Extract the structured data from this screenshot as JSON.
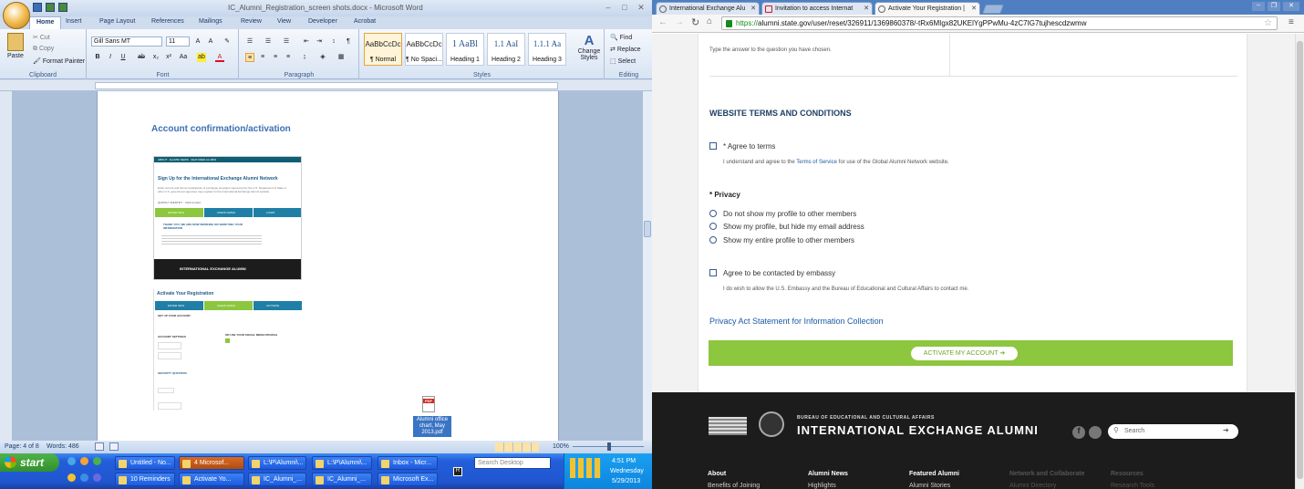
{
  "word": {
    "title": "IC_Alumni_Registration_screen shots.docx - Microsoft Word",
    "tabs": [
      "Home",
      "Insert",
      "Page Layout",
      "References",
      "Mailings",
      "Review",
      "View",
      "Developer",
      "Acrobat"
    ],
    "clipboard": {
      "paste": "Paste",
      "cut": "Cut",
      "copy": "Copy",
      "format_painter": "Format Painter",
      "label": "Clipboard"
    },
    "font": {
      "name": "Gill Sans MT",
      "size": "11",
      "label": "Font"
    },
    "paragraph_label": "Paragraph",
    "styles": [
      {
        "preview": "AaBbCcDc",
        "name": "¶ Normal"
      },
      {
        "preview": "AaBbCcDc",
        "name": "¶ No Spaci..."
      },
      {
        "preview": "1 AaBl",
        "name": "Heading 1"
      },
      {
        "preview": "1.1 AaI",
        "name": "Heading 2"
      },
      {
        "preview": "1.1.1 Aa",
        "name": "Heading 3"
      }
    ],
    "change_styles": "Change Styles",
    "styles_label": "Styles",
    "editing": {
      "find": "Find",
      "replace": "Replace",
      "select": "Select",
      "label": "Editing"
    },
    "doc": {
      "heading": "Account confirmation/activation",
      "mini1": {
        "nav": [
          "ABOUT",
          "ALUMNI NEWS",
          "FEATURED ALUMNI"
        ],
        "title": "Sign Up for the International Exchange Alumni Network",
        "intro": "Enter current and former participants of exchange programs sponsored by the U.S. Department of State or other U.S. government agencies may register for the International Exchange Alumni website.",
        "step_link": "QUICKLY IDENTIFY · Click to learn",
        "steps": [
          "ENTER INFO",
          "CHECK EMAIL",
          "LOGIN"
        ],
        "thanks": "THANK YOU, WE ARE NOW WORKING ON VERIFYING YOUR INFORMATION",
        "footer": "INTERNATIONAL EXCHANGE ALUMNI"
      },
      "mini2": {
        "title": "Activate Your Registration",
        "steps": [
          "ENTER INFO",
          "CHECK EMAIL",
          "ACTIVATE"
        ],
        "set_up": "SET UP YOUR ACCOUNT",
        "account_settings": "ACCOUNT SETTINGS",
        "social": "OR USE YOUR SOCIAL MEDIA PROFILE",
        "security": "SECURITY QUESTION"
      },
      "attachment": "Alumni office chart, May 2013.pdf"
    },
    "status": {
      "page": "Page: 4 of 8",
      "words": "Words: 486",
      "zoom": "100%"
    }
  },
  "taskbar": {
    "start": "start",
    "buttons": [
      {
        "label": "Untitled - No...",
        "active": false
      },
      {
        "label": "4 Microsof...",
        "active": true
      },
      {
        "label": "L:\\P\\Alumni\\...",
        "active": false
      },
      {
        "label": "L:\\P\\Alumni\\...",
        "active": false
      },
      {
        "label": "Inbox - Micr...",
        "active": false
      },
      {
        "label": "10 Reminders",
        "active": false
      },
      {
        "label": "Activate Yo...",
        "active": false
      },
      {
        "label": "IC_Alumni_...",
        "active": false
      },
      {
        "label": "IC_Alumni_...",
        "active": false
      },
      {
        "label": "Microsoft Ex...",
        "active": false
      }
    ],
    "search_placeholder": "Search Desktop",
    "clock": {
      "time": "4:51 PM",
      "day": "Wednesday",
      "date": "5/29/2013"
    }
  },
  "chrome": {
    "tabs": [
      {
        "label": "International Exchange Alu",
        "active": false
      },
      {
        "label": "Invitation to access Internat",
        "active": false
      },
      {
        "label": "Activate Your Registration |",
        "active": true
      }
    ],
    "url_scheme": "https://",
    "url_rest": "alumni.state.gov/user/reset/326911/1369860378/-tRx6MIgx82UKElYgPPwMu-4zC7IG7tujhescdzwmw",
    "page": {
      "answer_hint": "Type the answer to the question you have chosen.",
      "terms_heading": "WEBSITE TERMS AND CONDITIONS",
      "agree_label": "* Agree to terms",
      "agree_desc_pre": "I understand and agree to the ",
      "agree_desc_link": "Terms of Service",
      "agree_desc_post": " for use of the Global Alumni Network website.",
      "privacy_heading": "* Privacy",
      "privacy_options": [
        "Do not show my profile to other members",
        "Show my profile, but hide my email address",
        "Show my entire profile to other members"
      ],
      "embassy_label": "Agree to be contacted by embassy",
      "embassy_desc": "I do wish to allow the U.S. Embassy and the Bureau of Educational and Cultural Affairs to contact me.",
      "privacy_act_link": "Privacy Act Statement for Information Collection",
      "activate_button": "ACTIVATE MY ACCOUNT",
      "accent": "#8dc63f"
    },
    "footer": {
      "bureau": "BUREAU OF EDUCATIONAL AND CULTURAL AFFAIRS",
      "brand": "INTERNATIONAL EXCHANGE ALUMNI",
      "search_placeholder": "Search",
      "columns": [
        {
          "head": "About",
          "item": "Benefits of Joining"
        },
        {
          "head": "Alumni News",
          "item": "Highlights"
        },
        {
          "head": "Featured Alumni",
          "item": "Alumni Stories"
        },
        {
          "head": "Network and Collaborate",
          "item": "Alumni Directory"
        },
        {
          "head": "Resources",
          "item": "Research Tools"
        }
      ]
    }
  }
}
